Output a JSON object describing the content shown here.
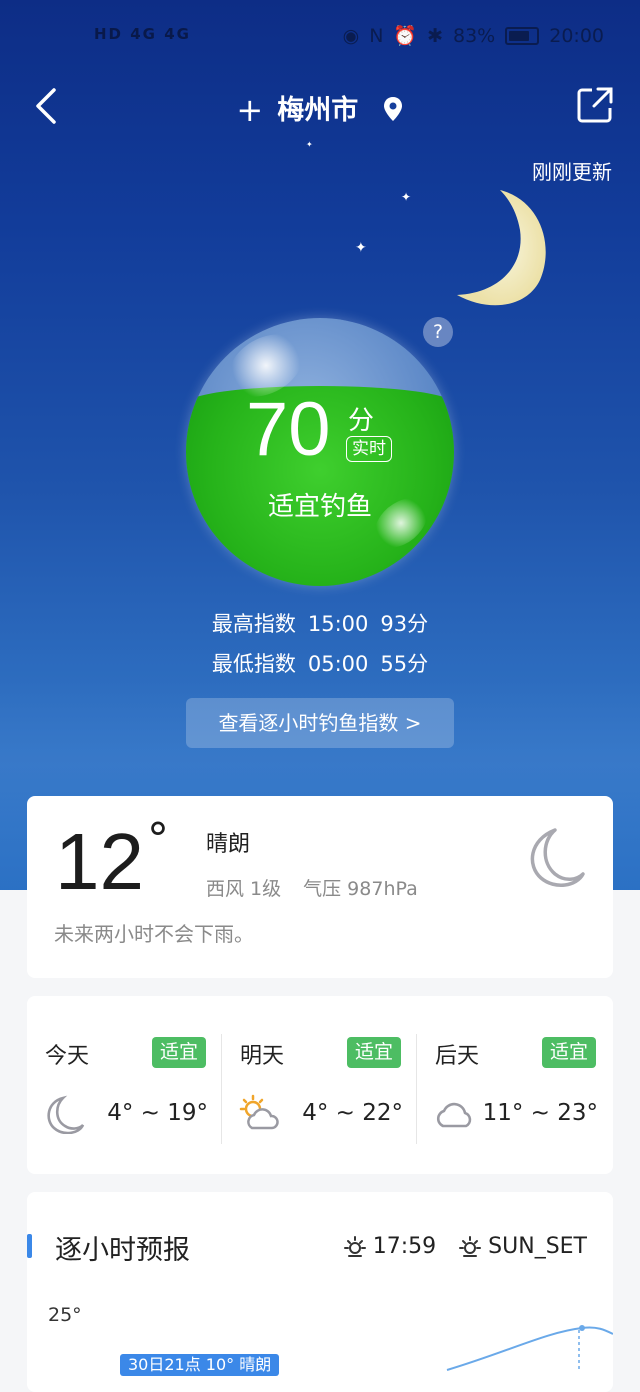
{
  "status_bar": {
    "left": "HD 4G 4G",
    "battery": "83%",
    "time": "20:00"
  },
  "header": {
    "city": "梅州市",
    "updated": "刚刚更新"
  },
  "index": {
    "score": "70",
    "unit": "分",
    "realtime": "实时",
    "verdict": "适宜钓鱼",
    "help": "?",
    "max": {
      "label": "最高指数",
      "time": "15:00",
      "value": "93分"
    },
    "min": {
      "label": "最低指数",
      "time": "05:00",
      "value": "55分"
    },
    "hourly_button": "查看逐小时钓鱼指数  >"
  },
  "current": {
    "temp": "12",
    "degree": "°",
    "condition": "晴朗",
    "wind": "西风  1级",
    "pressure": "气压  987hPa",
    "hint": "未来两小时不会下雨。"
  },
  "days": [
    {
      "name": "今天",
      "badge": "适宜",
      "icon": "moon-icon",
      "range": "4° ~ 19°"
    },
    {
      "name": "明天",
      "badge": "适宜",
      "icon": "partly-cloudy-icon",
      "range": "4° ~ 22°"
    },
    {
      "name": "后天",
      "badge": "适宜",
      "icon": "cloud-icon",
      "range": "11° ~ 23°"
    }
  ],
  "hourly": {
    "title": "逐小时预报",
    "sunrise_time": "17:59",
    "sunset_label": "SUN_SET",
    "y_top": "25°",
    "tooltip": "30日21点 10° 晴朗"
  },
  "colors": {
    "accent": "#3b88e8",
    "badge": "#4dbd63",
    "ball": "#26b31a"
  }
}
